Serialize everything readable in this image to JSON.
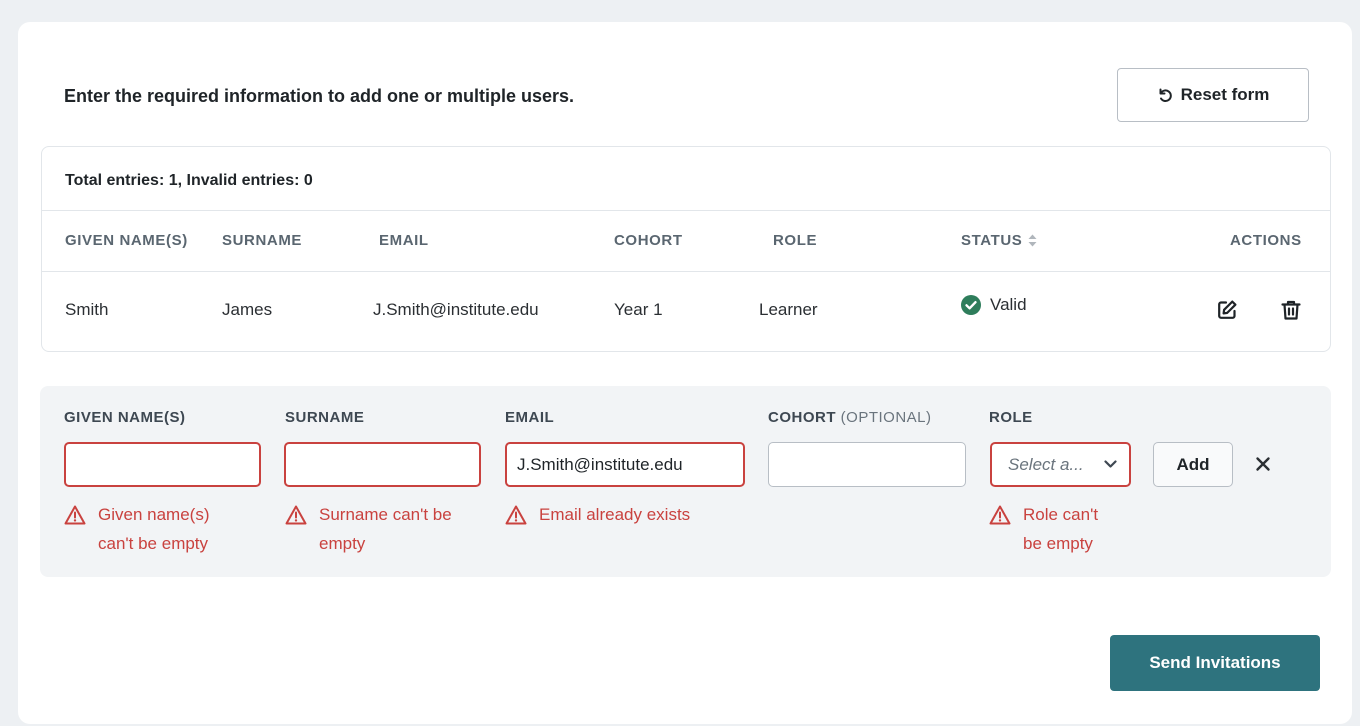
{
  "intro_text": "Enter the required information to add one or multiple users.",
  "reset_button": {
    "label": "Reset form",
    "icon": "undo-icon"
  },
  "table": {
    "totals": "Total entries: 1, Invalid entries: 0",
    "headers": {
      "given_names": "GIVEN NAME(S)",
      "surname": "SURNAME",
      "email": "EMAIL",
      "cohort": "COHORT",
      "role": "ROLE",
      "status": "STATUS",
      "actions": "ACTIONS"
    },
    "rows": [
      {
        "given_names": "Smith",
        "surname": "James",
        "email": "J.Smith@institute.edu",
        "cohort": "Year 1",
        "role": "Learner",
        "status": "Valid",
        "status_icon": "check-circle-icon",
        "actions": [
          "edit-icon",
          "trash-icon"
        ]
      }
    ]
  },
  "form": {
    "labels": {
      "given_names": "GIVEN NAME(S)",
      "surname": "SURNAME",
      "email": "EMAIL",
      "cohort": "COHORT",
      "cohort_optional": "(OPTIONAL)",
      "role": "ROLE"
    },
    "values": {
      "given_names": "",
      "surname": "",
      "email": "J.Smith@institute.edu",
      "cohort": ""
    },
    "role_placeholder": "Select a...",
    "add_label": "Add",
    "errors": {
      "given_names_line1": "Given name(s)",
      "given_names_line2": "can't be empty",
      "surname_line1": "Surname can't be",
      "surname_line2": "empty",
      "email": "Email already exists",
      "role_line1": "Role can't",
      "role_line2": "be empty"
    }
  },
  "send_button": {
    "label": "Send Invitations"
  },
  "colors": {
    "accent": "#2e737e",
    "error": "#c9423f",
    "valid": "#2e7d5b",
    "page_bg": "#edf0f3"
  }
}
